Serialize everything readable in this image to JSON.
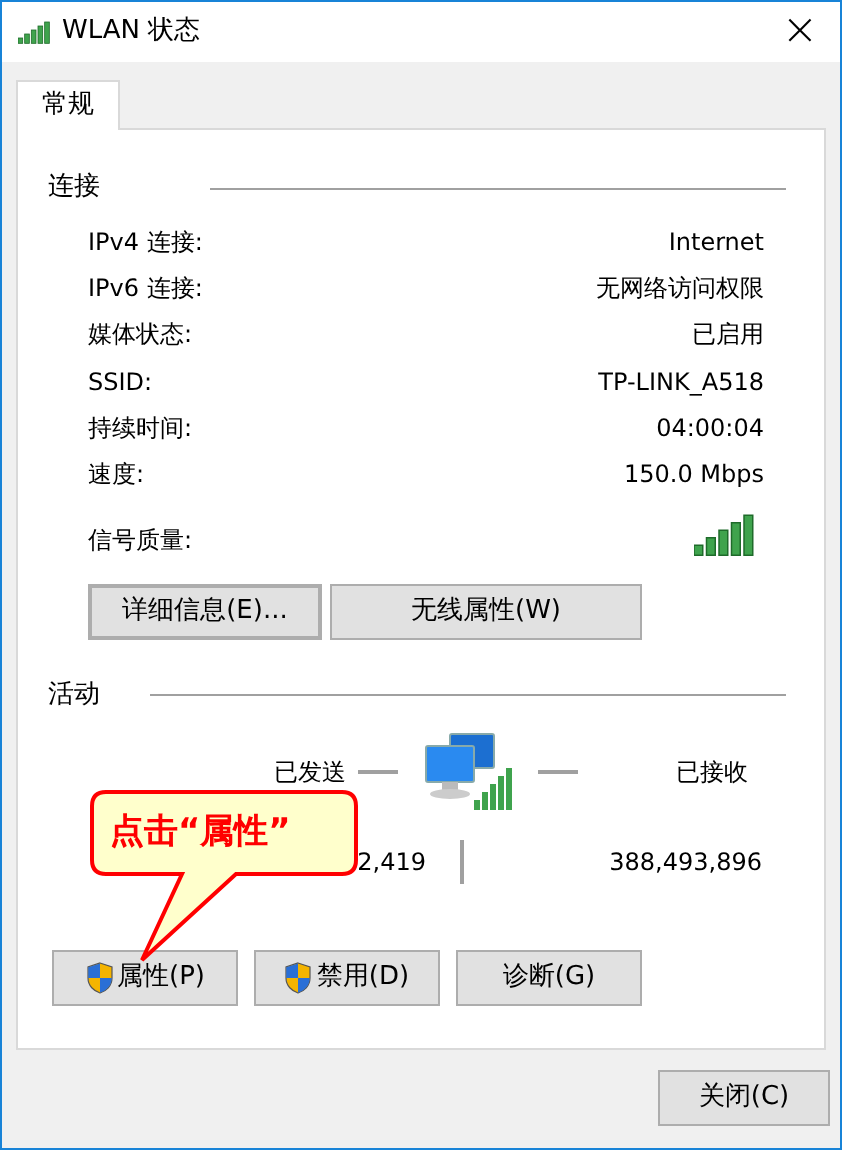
{
  "window": {
    "title": "WLAN 状态",
    "close": "×"
  },
  "tabs": [
    {
      "label": "常规",
      "selected": true
    }
  ],
  "connection": {
    "title": "连接",
    "rows": [
      {
        "label": "IPv4 连接:",
        "value": "Internet"
      },
      {
        "label": "IPv6 连接:",
        "value": "无网络访问权限"
      },
      {
        "label": "媒体状态:",
        "value": "已启用"
      },
      {
        "label": "SSID:",
        "value": "TP-LINK_A518"
      },
      {
        "label": "持续时间:",
        "value": "04:00:04"
      },
      {
        "label": "速度:",
        "value": "150.0 Mbps"
      }
    ],
    "signal_label": "信号质量:",
    "buttons": [
      {
        "label": "详细信息(E)..."
      },
      {
        "label": "无线属性(W)"
      }
    ]
  },
  "activity": {
    "title": "活动",
    "sent_label": "已发送",
    "received_label": "已接收",
    "bytes_sent": "2,419",
    "bytes_received": "388,493,896",
    "buttons": [
      {
        "label": "属性(P)",
        "shield": true
      },
      {
        "label": "禁用(D)",
        "shield": true
      },
      {
        "label": "诊断(G)",
        "shield": false
      }
    ]
  },
  "close_button": "关闭(C)",
  "callout": {
    "text": "点击“属性”"
  }
}
